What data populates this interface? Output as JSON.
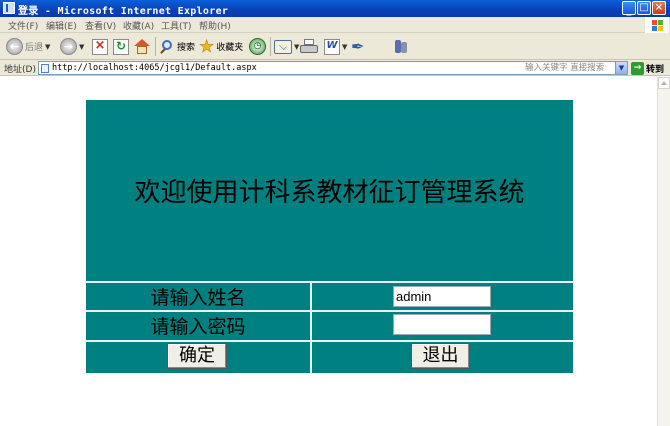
{
  "window": {
    "title": "登录 - Microsoft Internet Explorer"
  },
  "menu": {
    "items": [
      "文件(F)",
      "编辑(E)",
      "查看(V)",
      "收藏(A)",
      "工具(T)",
      "帮助(H)"
    ]
  },
  "toolbar": {
    "back_label": "后退",
    "search_label": "搜索",
    "favorites_label": "收藏夹"
  },
  "address": {
    "label": "地址(D)",
    "url": "http://localhost:4065/jcgl1/Default.aspx",
    "hint": "输入关键字 直接搜索",
    "go_label": "转到"
  },
  "login": {
    "banner": "欢迎使用计科系教材征订管理系统",
    "name_label": "请输入姓名",
    "name_value": "admin",
    "password_label": "请输入密码",
    "password_value": "",
    "confirm_label": "确定",
    "exit_label": "退出",
    "panel_color": "#008080"
  }
}
